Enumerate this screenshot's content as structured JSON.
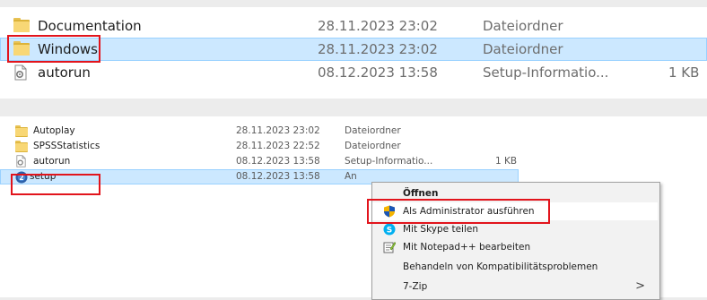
{
  "top_list": {
    "rows": [
      {
        "name": "Documentation",
        "date": "28.11.2023 23:02",
        "type": "Dateiordner",
        "size": "",
        "icon": "folder-icon",
        "selected": false
      },
      {
        "name": "Windows",
        "date": "28.11.2023 23:02",
        "type": "Dateiordner",
        "size": "",
        "icon": "folder-icon",
        "selected": true
      },
      {
        "name": "autorun",
        "date": "08.12.2023 13:58",
        "type": "Setup-Informatio...",
        "size": "1 KB",
        "icon": "settings-file-icon",
        "selected": false
      }
    ]
  },
  "bottom_list": {
    "rows": [
      {
        "name": "Autoplay",
        "date": "28.11.2023 23:02",
        "type": "Dateiordner",
        "size": "",
        "icon": "folder-icon",
        "selected": false
      },
      {
        "name": "SPSSStatistics",
        "date": "28.11.2023 22:52",
        "type": "Dateiordner",
        "size": "",
        "icon": "folder-icon",
        "selected": false
      },
      {
        "name": "autorun",
        "date": "08.12.2023 13:58",
        "type": "Setup-Informatio...",
        "size": "1 KB",
        "icon": "settings-file-icon",
        "selected": false
      },
      {
        "name": "setup",
        "date": "08.12.2023 13:58",
        "type": "An",
        "size": "",
        "icon": "setup-app-icon",
        "selected": true
      }
    ]
  },
  "context_menu": {
    "items": [
      {
        "label": "Öffnen",
        "icon": "",
        "bold": true
      },
      {
        "label": "Als Administrator ausführen",
        "icon": "uac-shield-icon",
        "bold": false
      },
      {
        "label": "Mit Skype teilen",
        "icon": "skype-icon",
        "bold": false
      },
      {
        "label": "Mit Notepad++ bearbeiten",
        "icon": "notepadpp-icon",
        "bold": false
      },
      {
        "label": "Behandeln von Kompatibilitätsproblemen",
        "icon": "",
        "bold": false
      },
      {
        "label": "7-Zip",
        "icon": "",
        "bold": false,
        "submenu": true
      }
    ],
    "submenu_arrow": ">"
  },
  "colors": {
    "selection": "#cce8ff",
    "highlight_box": "#e2141c",
    "folder": "#f8d775"
  }
}
